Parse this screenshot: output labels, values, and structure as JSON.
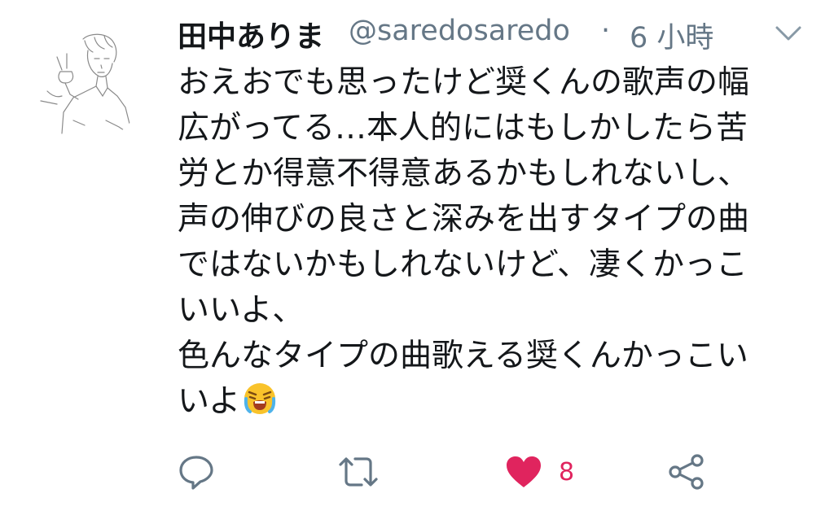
{
  "tweet": {
    "display_name": "田中ありま",
    "handle": "@saredosaredo",
    "separator": "·",
    "timestamp": "6 小時",
    "text_lines": [
      "おえおでも思ったけど奨くんの歌声の幅",
      "広がってる…本人的にはもしかしたら苦",
      "労とか得意不得意あるかもしれないし、",
      "声の伸びの良さと深みを出すタイプの曲",
      "ではないかもしれないけど、凄くかっこ",
      "いいよ、",
      "色んなタイプの曲歌える奨くんかっこい",
      "いよ"
    ],
    "emoji": "loudly-crying-face",
    "actions": {
      "reply_icon": "reply-icon",
      "retweet_icon": "retweet-icon",
      "like_icon": "heart-icon",
      "like_count": "8",
      "share_icon": "share-icon",
      "like_color": "#e0245e",
      "icon_color": "#657786"
    }
  }
}
